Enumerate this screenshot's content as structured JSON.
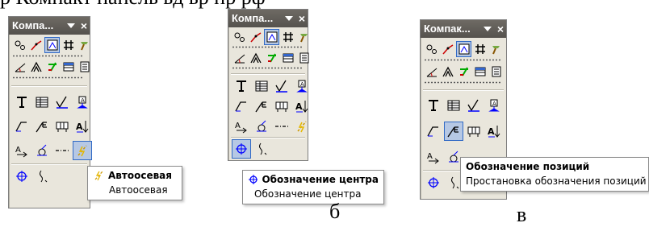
{
  "caption_top": "р  Компакт  панель   ьд ьр  пр   рф",
  "panels": [
    {
      "title": "Компа...",
      "tooltip": {
        "title": "Автоосевая",
        "body": "Автоосевая"
      }
    },
    {
      "title": "Компа...",
      "tooltip": {
        "title": "Обозначение центра",
        "body": "Обозначение центра"
      }
    },
    {
      "title": "Компак...",
      "tooltip": {
        "title": "Обозначение позиций",
        "body": "Простановка обозначения позиций"
      }
    }
  ],
  "labels": {
    "b": "б",
    "v": "в"
  },
  "icons": {
    "row1": [
      "point-icon",
      "curve-icon",
      "dimension-icon",
      "hatch-icon",
      "hammer-icon"
    ],
    "row2": [
      "angle-icon",
      "polyline-icon",
      "check-icon",
      "table-icon",
      "document-icon"
    ],
    "row3": [
      "text-icon",
      "table-grid-icon",
      "roughness-icon",
      "base-icon"
    ],
    "row4": [
      "leader-icon",
      "position-icon",
      "form-tolerance-icon",
      "sort-icon"
    ],
    "row5": [
      "arrow-icon",
      "section-icon",
      "axis-icon",
      "auto-axis-icon"
    ],
    "row6": [
      "center-mark-icon",
      "wavy-line-icon"
    ]
  },
  "colors": {
    "title_bg": "#5f5b57",
    "panel_bg": "#e9e6dc",
    "active": "#b6c8e4",
    "accent": "#316ac5"
  }
}
